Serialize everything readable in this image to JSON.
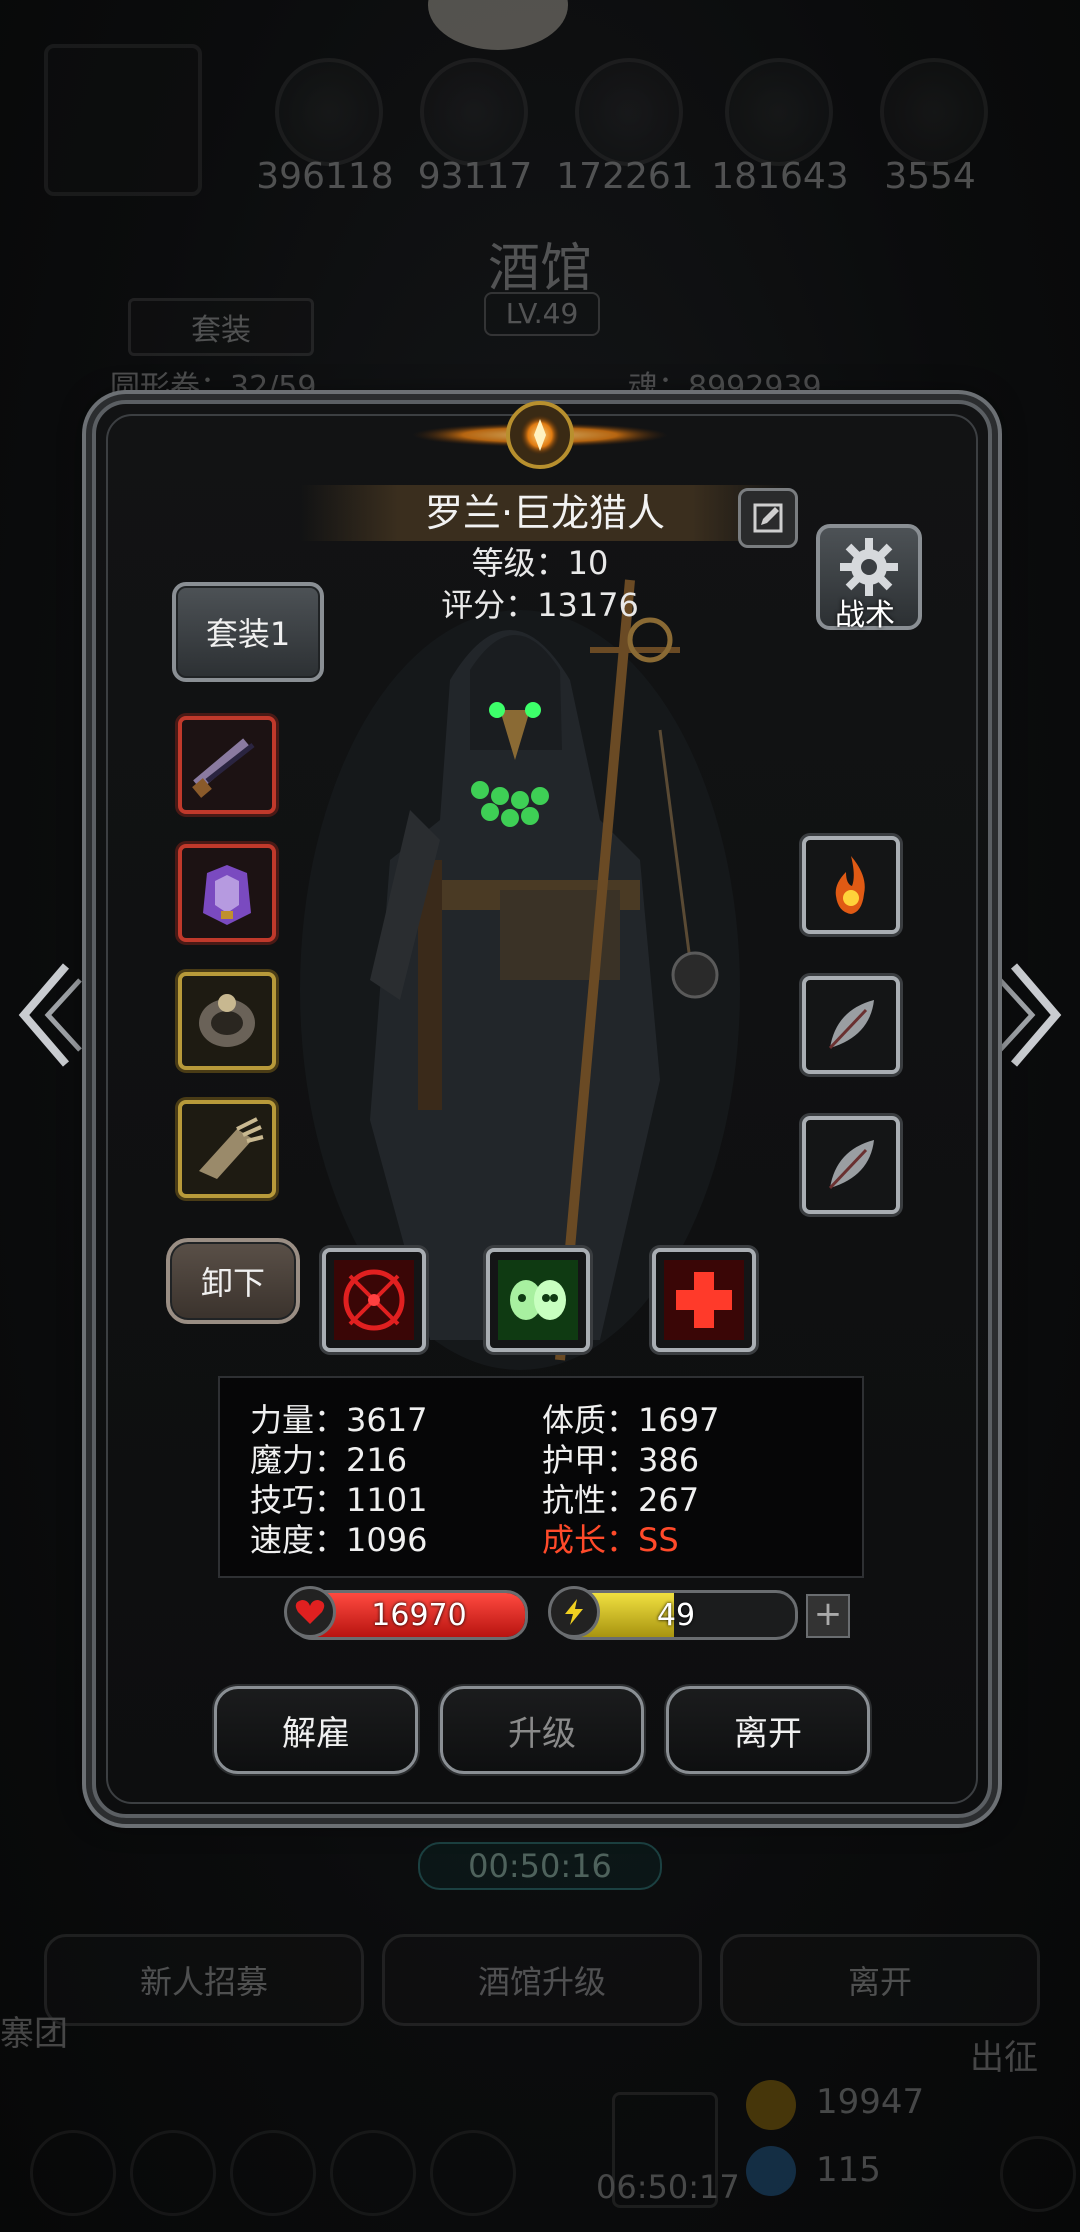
{
  "background": {
    "resources": [
      "396118",
      "93117",
      "172261",
      "181643",
      "3554"
    ],
    "title": "酒馆",
    "level": "LV.49",
    "tab_suit": "套装",
    "left_stat": "圆形卷：32/59",
    "right_stat": "魂：8992939",
    "timer": "00:50:16",
    "buttons": [
      "新人招募",
      "酒馆升级",
      "离开"
    ],
    "side_label_left": "寨团",
    "side_label_right": "出征",
    "gold_count": "19947",
    "gem_count": "115",
    "bottom_timer": "06:50:17"
  },
  "hero": {
    "name": "罗兰·巨龙猎人",
    "level_text": "等级：10",
    "score_text": "评分：13176",
    "suit_button": "套装1",
    "tactic_label": "战术",
    "unequip_button": "卸下"
  },
  "equipment_slots": [
    {
      "icon": "crossbow-icon",
      "rarity": "red"
    },
    {
      "icon": "armor-icon",
      "rarity": "red"
    },
    {
      "icon": "ring-icon",
      "rarity": "gold"
    },
    {
      "icon": "gauntlet-icon",
      "rarity": "gold"
    }
  ],
  "rune_slots": [
    {
      "icon": "fire-rune-icon"
    },
    {
      "icon": "feather-icon"
    },
    {
      "icon": "feather-icon"
    }
  ],
  "skills": [
    {
      "icon": "crosshair-skill-icon"
    },
    {
      "icon": "twin-skull-skill-icon"
    },
    {
      "icon": "heal-cross-skill-icon"
    }
  ],
  "stats": {
    "left": [
      "力量：3617",
      "魔力：216",
      "技巧：1101",
      "速度：1096"
    ],
    "right": [
      "体质：1697",
      "护甲：386",
      "抗性：267",
      "成长：SS"
    ]
  },
  "bars": {
    "hp_value": "16970",
    "hp_fill": 1.0,
    "energy_value": "49",
    "energy_fill": 0.49
  },
  "actions": {
    "dismiss": "解雇",
    "upgrade": "升级",
    "leave": "离开"
  },
  "colors": {
    "accent_red": "#c0392b",
    "accent_gold": "#b89a3a",
    "growth": "#ff4a2a"
  }
}
